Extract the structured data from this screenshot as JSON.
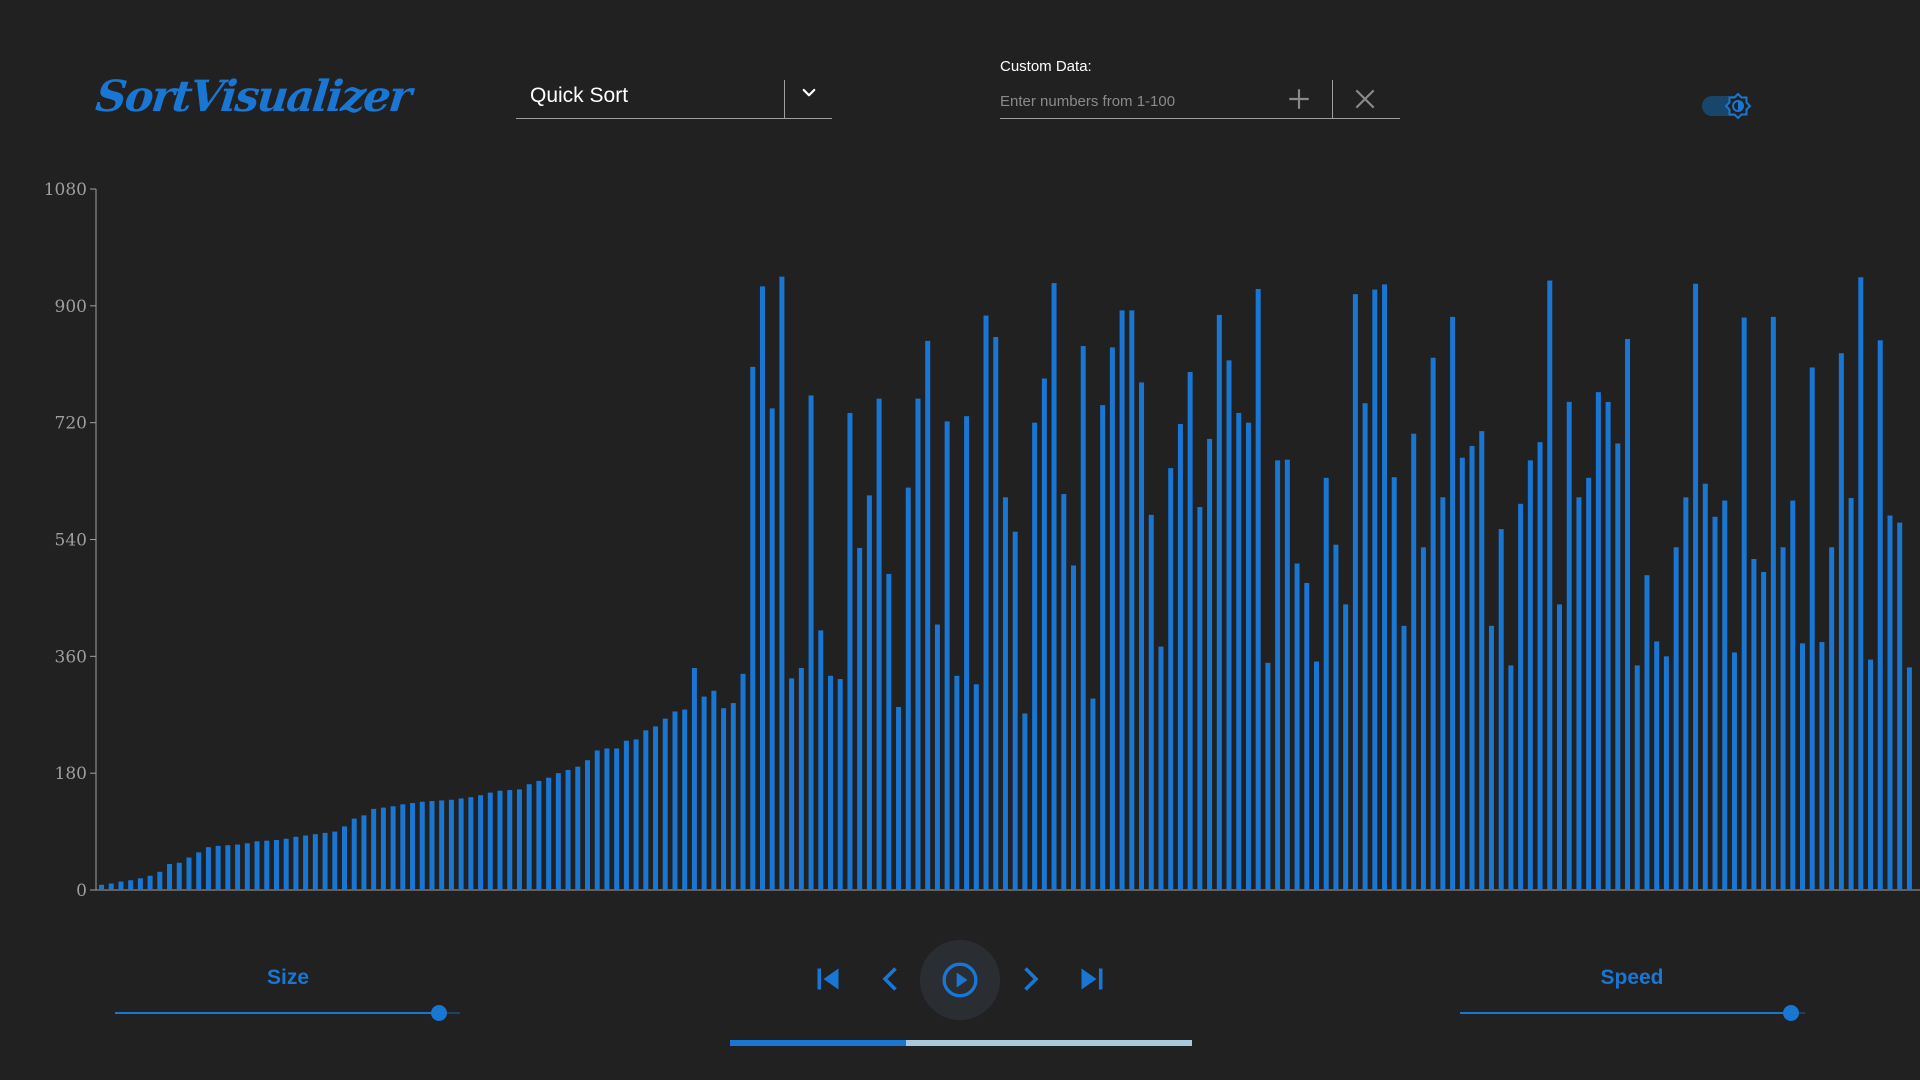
{
  "app": {
    "logo_text": "SortVisualizer"
  },
  "algorithm_select": {
    "selected": "Quick Sort"
  },
  "custom_data": {
    "label": "Custom Data:",
    "placeholder": "Enter numbers from 1-100",
    "value": ""
  },
  "theme_toggle": {
    "state": "dark"
  },
  "controls": {
    "size_label": "Size",
    "size_value_fraction": 0.94,
    "speed_label": "Speed",
    "speed_value_fraction": 0.96,
    "progress_fraction": 0.38
  },
  "icons": {
    "algorithm_dropdown": "chevron-down-icon",
    "custom_add": "plus-icon",
    "custom_clear": "close-icon",
    "theme": "brightness-icon",
    "first": "skip-previous-icon",
    "prev": "chevron-left-icon",
    "play": "play-circle-icon",
    "next": "chevron-right-icon",
    "last": "skip-next-icon"
  },
  "colors": {
    "background": "#212121",
    "accent": "#1976d2",
    "axis": "#9e9e9e",
    "progress_rest": "#a8c8dc"
  },
  "chart_data": {
    "type": "bar",
    "title": "",
    "xlabel": "",
    "ylabel": "",
    "ylim": [
      0,
      1080
    ],
    "yticks": [
      0,
      180,
      360,
      540,
      720,
      900,
      1080
    ],
    "grid": false,
    "values": [
      8,
      10,
      13,
      15,
      18,
      22,
      28,
      40,
      42,
      50,
      58,
      66,
      68,
      69,
      70,
      72,
      75,
      76,
      77,
      79,
      82,
      84,
      86,
      88,
      90,
      98,
      110,
      115,
      125,
      127,
      129,
      132,
      134,
      136,
      137,
      138,
      139,
      141,
      143,
      146,
      150,
      153,
      154,
      155,
      163,
      168,
      173,
      180,
      185,
      190,
      200,
      215,
      218,
      218,
      230,
      232,
      246,
      252,
      264,
      275,
      278,
      342,
      298,
      307,
      280,
      288,
      333,
      806,
      930,
      742,
      945,
      326,
      342,
      762,
      400,
      330,
      325,
      735,
      527,
      608,
      757,
      487,
      282,
      620,
      757,
      846,
      409,
      722,
      330,
      730,
      317,
      885,
      852,
      605,
      552,
      272,
      720,
      788,
      935,
      610,
      500,
      838,
      295,
      747,
      836,
      893,
      893,
      782,
      578,
      375,
      650,
      718,
      798,
      590,
      695,
      886,
      816,
      735,
      720,
      926,
      350,
      662,
      663,
      503,
      473,
      352,
      635,
      532,
      440,
      918,
      750,
      925,
      933,
      636,
      407,
      703,
      528,
      820,
      605,
      883,
      666,
      684,
      707,
      407,
      556,
      346,
      595,
      662,
      690,
      939,
      440,
      752,
      605,
      635,
      767,
      752,
      688,
      849,
      346,
      485,
      383,
      360,
      528,
      605,
      934,
      626,
      575,
      600,
      366,
      882,
      510,
      490,
      883,
      528,
      600,
      380,
      805,
      382,
      528,
      827,
      604,
      944,
      355,
      847,
      577,
      566,
      343
    ]
  }
}
